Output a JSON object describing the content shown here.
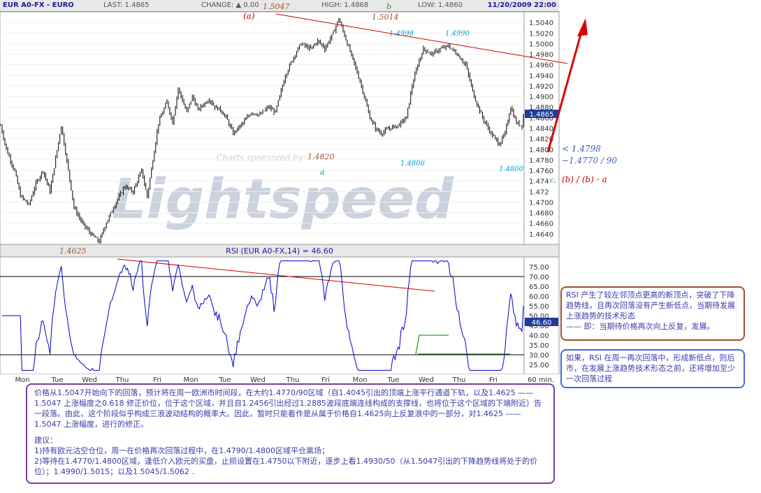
{
  "header": {
    "symbol": "EUR A0-FX - EURO",
    "last": "LAST: 1.4865",
    "change": "CHANGE: ▲ 0.00",
    "high": "HIGH: 1.4868",
    "low": "LOW: 1.4860",
    "datetime": "11/20/2009 22:00"
  },
  "watermark": {
    "sponsored": "Charts sponsored by:",
    "logo": "Lightspeed"
  },
  "chart_data": [
    {
      "type": "line",
      "title": "",
      "ylim": [
        1.462,
        1.506
      ],
      "price_ticks": [
        1.504,
        1.502,
        1.5,
        1.498,
        1.496,
        1.494,
        1.492,
        1.49,
        1.488,
        1.486,
        1.484,
        1.482,
        1.48,
        1.478,
        1.476,
        1.474,
        1.472,
        1.47,
        1.468,
        1.466,
        1.464
      ],
      "price_tick_labels": [
        "1.5040",
        "1.5020",
        "1.5000",
        "1.4980",
        "1.4960",
        "1.4940",
        "1.4920",
        "1.4900",
        "1.4880",
        "1.4860",
        "1.4840",
        "1.4820",
        "1.4800",
        "1.4780",
        "1.4760",
        "1.474",
        "1.472",
        "1.4700",
        "1.4680",
        "1.4660",
        "1.4640"
      ],
      "last_price_label": "1.4865",
      "x_labels": [
        "Mon",
        "Tue",
        "Wed",
        "Thu",
        "Fri",
        "Mon",
        "Tue",
        "Wed",
        "Thu",
        "Fri",
        "Mon",
        "Tue",
        "Wed",
        "Thu",
        "Fri",
        "60 min."
      ],
      "path_t": [
        0,
        4,
        10,
        14,
        20,
        25,
        30,
        35,
        43,
        48,
        52,
        58,
        64,
        70,
        74,
        80,
        88,
        94,
        100,
        104,
        108,
        112,
        118,
        122,
        126,
        132,
        136,
        140,
        148,
        152,
        156,
        160,
        165,
        172,
        178,
        184,
        190,
        195,
        198,
        202,
        208,
        213,
        220,
        225,
        229
      ],
      "path_v": [
        1.4845,
        1.48,
        1.4758,
        1.4712,
        1.4695,
        1.4735,
        1.476,
        1.472,
        1.4845,
        1.476,
        1.469,
        1.466,
        1.464,
        1.4625,
        1.4655,
        1.469,
        1.473,
        1.472,
        1.476,
        1.471,
        1.478,
        1.485,
        1.489,
        1.485,
        1.4915,
        1.487,
        1.49,
        1.4875,
        1.4895,
        1.488,
        1.4875,
        1.486,
        1.483,
        1.485,
        1.487,
        1.4865,
        1.488,
        1.487,
        1.49,
        1.494,
        1.4975,
        1.5,
        1.499,
        1.5005,
        1.4995
      ],
      "annotations": {
        "a_top": "(a)",
        "a_top_price": "1.5047",
        "b_label": "b",
        "b_price": "1.5014",
        "p1498": "1.4998",
        "p1490": "1.4990",
        "p1482": "1.4820",
        "a_small": "a",
        "p1480a": "1.4806",
        "p1480b": "1.4800",
        "low_price": "1.4625",
        "t1": "< 1.4798",
        "t2": "~1.4770 / 90",
        "c_label": "c,",
        "wave": "(b) / (b) - a"
      }
    },
    {
      "type": "line",
      "title": "RSI (EUR A0-FX,14) = 46.60",
      "ylim": [
        20,
        80
      ],
      "rsi_ticks": [
        75,
        70,
        65,
        60,
        55,
        50,
        45,
        40,
        35,
        30,
        25
      ],
      "rsi_tick_labels": [
        "75.00",
        "70.00",
        "65.00",
        "60.00",
        "55.00",
        "50.00",
        "45.00",
        "40.00",
        "35.00",
        "30.00",
        "25.00"
      ],
      "last_rsi_label": "46.60",
      "levels": [
        70,
        30
      ]
    }
  ],
  "notes": {
    "rsi_note": "RSI 产生了较左邻顶点更高的新顶点，突破了下降趋势线，且再次回落没有产生新低点，当期待发展上涨趋势的技术形态\n—— 即：当期待价格再次向上反复，发展。",
    "rsi_note2": "如果，RSI 在周一再次回落中，形成新低点，则后市，在发展上涨趋势技术形态之前，还将增加至少一次回落过程",
    "main_note_p1": "价格从1.5047开始向下的回落，预计将在周一欧洲市时间段，在大约1.4770/90区域（自1.4045引出的顶端上涨平行通道下轨，以及1.4625 —— 1.5047 上涨幅度之0.618 修正价位，位于这个区域，并且自1.2456引出经过1.2885波段底端连线构成的支撑线，也将位于这个区域的下端附近）告一段落。由此，这个阶段似乎构成三浪波动结构的概率大。因此，暂时只能看作是从属于价格自1.4625向上反复浪中的一部分，对1.4625 —— 1.5047 上涨幅度，进行的修正。",
    "main_note_p2": "建议：",
    "main_note_p3": "1)持有欧元沽空仓位，周一在价格再次回落过程中，在1.4790/1.4800区域平仓离场；",
    "main_note_p4": "2)等待在1.4770/1.4800区域，逢低介入欧元的买盘，止损设置在1.4750以下附近，逐步上看1.4930/50（从1.5047引出的下降趋势线将处于的价位）；1.4990/1.5015；以及1.5045/1.5062 ."
  },
  "colors": {
    "candle": "#000000",
    "rsi_line": "#0000cc",
    "trendline": "#cc0000",
    "support_line": "#008000",
    "last_tag_bg": "#1f3b9e",
    "watermark_text": "#c9d2dd",
    "ann_brown": "#a0522d",
    "ann_cyan": "#00a0d8",
    "ann_green": "#10a050",
    "ann_red": "#cc0000",
    "ann_blue": "#3a5fb0"
  }
}
